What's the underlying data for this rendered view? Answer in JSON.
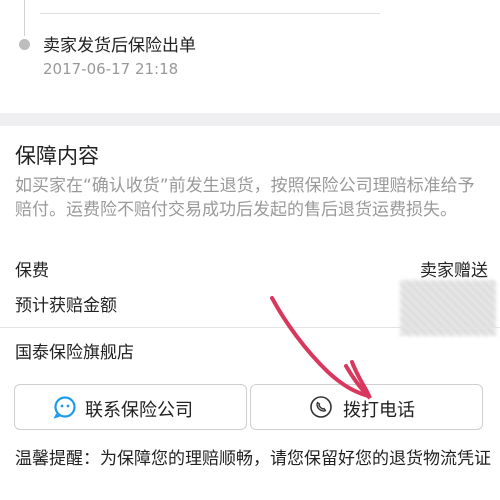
{
  "timeline": {
    "event_title": "卖家发货后保险出单",
    "event_time": "2017-06-17 21:18"
  },
  "protection": {
    "title": "保障内容",
    "description": "如买家在“确认收货”前发生退货，按照保险公司理赔标准给予赔付。运费险不赔付交易成功后发起的售后退货运费损失。",
    "premium_label": "保费",
    "premium_value": "卖家赠送",
    "expected_compensation_label": "预计获赔金额",
    "store_name": "国泰保险旗舰店"
  },
  "buttons": {
    "contact_label": "联系保险公司",
    "contact_icon": "chat-bubble-icon",
    "call_label": "拨打电话",
    "call_icon": "phone-icon"
  },
  "tip": {
    "text": "温馨提醒：为保障您的理赔顺畅，请您保留好您的退货物流凭证"
  },
  "colors": {
    "accent_blue": "#1E9BE8",
    "annotation_red": "#D8385E",
    "muted_text": "#999999",
    "gap_background": "#EFEFF1"
  }
}
